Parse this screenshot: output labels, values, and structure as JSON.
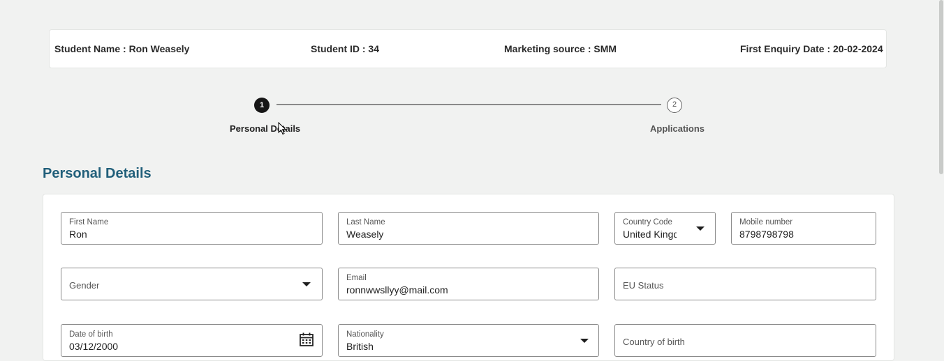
{
  "header": {
    "student_name": "Student Name : Ron Weasely",
    "student_id": "Student ID : 34",
    "marketing_source": "Marketing source : SMM",
    "first_enquiry": "First Enquiry Date : 20-02-2024"
  },
  "stepper": {
    "steps": [
      {
        "number": "1",
        "label": "Personal Details"
      },
      {
        "number": "2",
        "label": "Applications"
      }
    ]
  },
  "section": {
    "title": "Personal Details"
  },
  "form": {
    "first_name": {
      "label": "First Name",
      "value": "Ron"
    },
    "last_name": {
      "label": "Last Name",
      "value": "Weasely"
    },
    "country_code": {
      "label": "Country Code",
      "value": "United Kingdom"
    },
    "mobile": {
      "label": "Mobile number",
      "value": "8798798798"
    },
    "gender": {
      "placeholder": "Gender"
    },
    "email": {
      "label": "Email",
      "value": "ronnwwsllyy@mail.com"
    },
    "eu_status": {
      "placeholder": "EU Status"
    },
    "dob": {
      "label": "Date of birth",
      "value": "03/12/2000"
    },
    "nationality": {
      "label": "Nationality",
      "value": "British"
    },
    "country_of_birth": {
      "placeholder": "Country of birth"
    }
  },
  "icons": {
    "calendar": "calendar-icon",
    "dropdown": "chevron-down-icon",
    "cursor": "mouse-pointer-icon"
  }
}
